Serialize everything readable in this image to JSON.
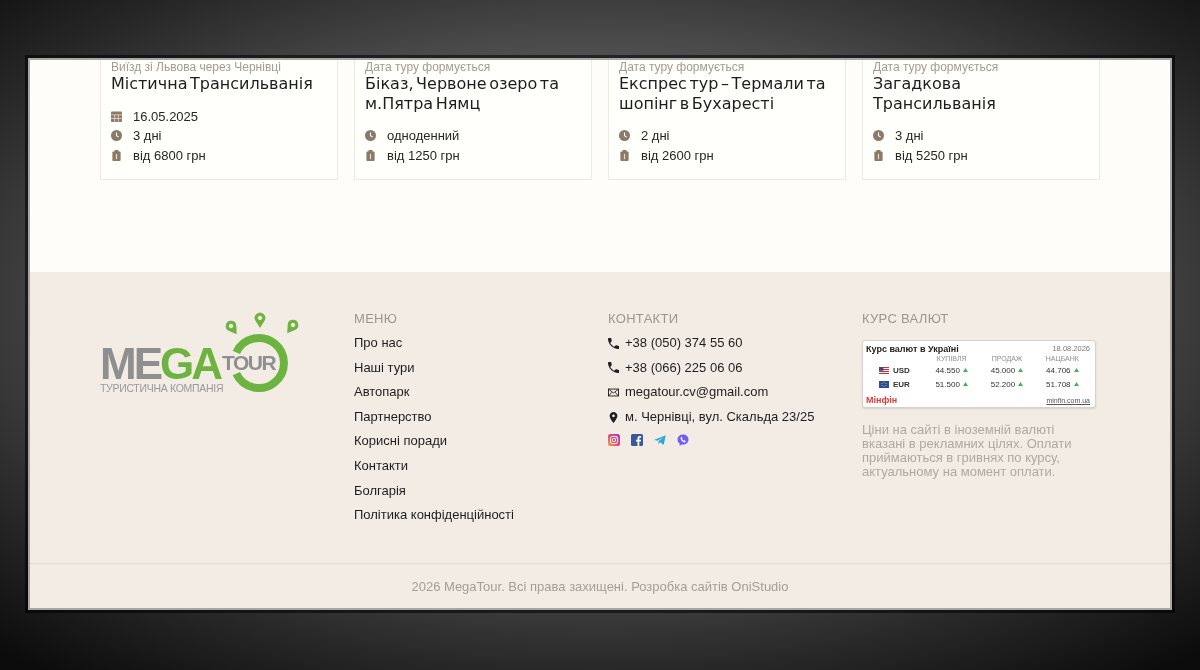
{
  "tours": [
    {
      "subtitle": "Виїзд зі Львова через Чернівці",
      "title": "Містична Трансильванія",
      "meta": [
        {
          "kind": "date",
          "text": "16.05.2025"
        },
        {
          "kind": "duration",
          "text": "3 дні"
        },
        {
          "kind": "price",
          "text": "від 6800 грн"
        }
      ]
    },
    {
      "subtitle": "Дата туру формується",
      "title": "Біказ, Червоне озеро та м.Пятра Нямц",
      "meta": [
        {
          "kind": "duration",
          "text": "одноденний"
        },
        {
          "kind": "price",
          "text": "від 1250 грн"
        }
      ]
    },
    {
      "subtitle": "Дата туру формується",
      "title": "Експрес тур – Термали та шопінг в Бухаресті",
      "meta": [
        {
          "kind": "duration",
          "text": "2 дні"
        },
        {
          "kind": "price",
          "text": "від 2600 грн"
        }
      ]
    },
    {
      "subtitle": "Дата туру формується",
      "title": "Загадкова Трансильванія",
      "meta": [
        {
          "kind": "duration",
          "text": "3 дні"
        },
        {
          "kind": "price",
          "text": "від 5250 грн"
        }
      ]
    }
  ],
  "footer": {
    "logo": {
      "wordmark": [
        {
          "text": "ME",
          "kind": "plain"
        },
        {
          "text": "GA",
          "kind": "accent"
        }
      ],
      "suffix": "TOUR",
      "tagline": "ТУРИСТИЧНА КОМПАНІЯ"
    },
    "menu": {
      "heading": "МЕНЮ",
      "items": [
        "Про нас",
        "Наші тури",
        "Автопарк",
        "Партнерство",
        "Корисні поради",
        "Контакти",
        "Болгарія",
        "Політика конфіденційності"
      ]
    },
    "contacts": {
      "heading": "КОНТАКТИ",
      "items": [
        {
          "kind": "phone",
          "text": "+38 (050) 374 55 60"
        },
        {
          "kind": "phone",
          "text": "+38 (066) 225 06 06"
        },
        {
          "kind": "email",
          "text": "megatour.cv@gmail.com"
        },
        {
          "kind": "address",
          "text": "м. Чернівці, вул. Скальда 23/25"
        }
      ]
    },
    "rates": {
      "heading": "КУРС ВАЛЮТ",
      "widget": {
        "title": "Курс валют в Україні",
        "date": "18.08.2026",
        "columns": [
          "КУПІВЛЯ",
          "ПРОДАЖ",
          "НАЦБАНК"
        ],
        "rows": [
          {
            "kind": "usd",
            "code": "USD",
            "values": [
              {
                "value": "44.550",
                "rising": true
              },
              {
                "value": "45.000",
                "rising": true
              },
              {
                "value": "44.706",
                "rising": true
              }
            ]
          },
          {
            "kind": "eur",
            "code": "EUR",
            "values": [
              {
                "value": "51.500",
                "rising": true
              },
              {
                "value": "52.200",
                "rising": true
              },
              {
                "value": "51.708",
                "rising": true
              }
            ]
          }
        ],
        "brand": "Мінфін",
        "link": "minfin.com.ua"
      },
      "note": "Ціни на сайті в іноземній валюті вказані в рекламних цілях. Оплати приймаються в гривнях по курсу, актуальному на момент оплати."
    }
  },
  "copyright": "2026 MegaTour. Всі права захищені. Розробка сайтів OniStudio"
}
